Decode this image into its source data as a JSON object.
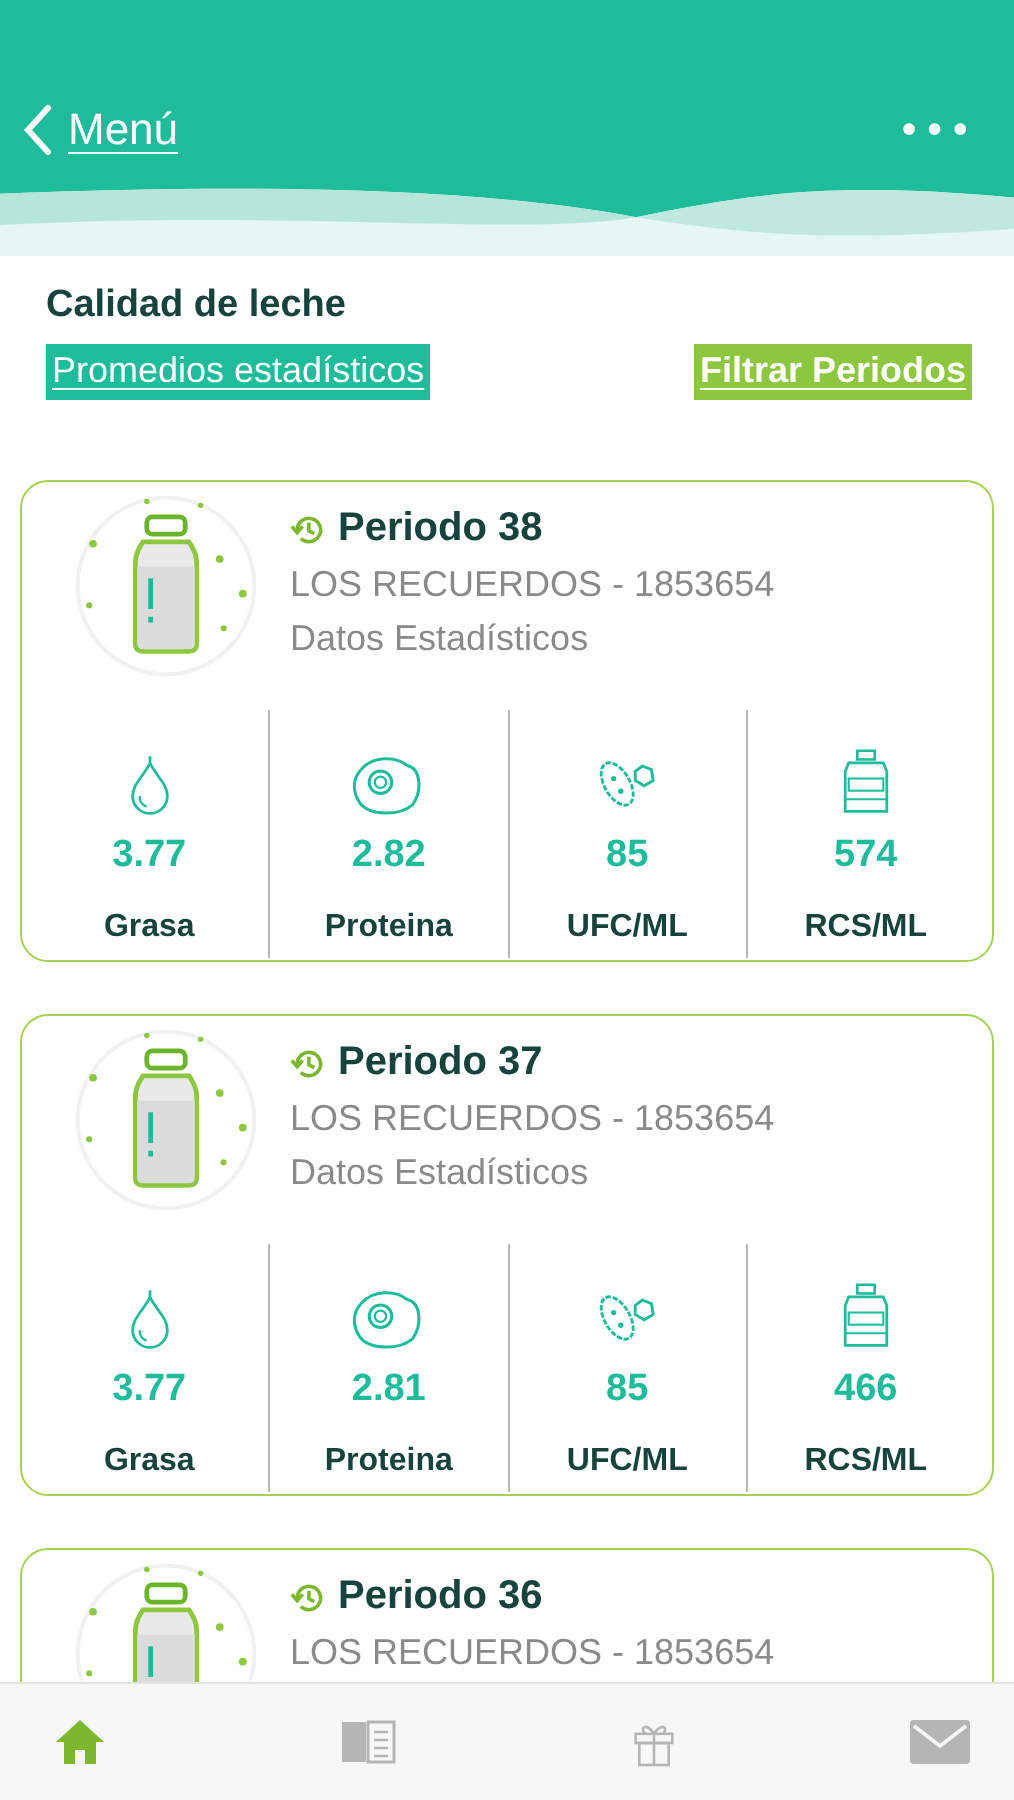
{
  "header": {
    "back_label": "Menú",
    "more": "•••"
  },
  "page_title": "Calidad de leche",
  "actions": [
    {
      "label": "Promedios estadísticos",
      "kind": "primary"
    },
    {
      "label": "Filtrar Periodos",
      "kind": "secondary"
    }
  ],
  "periods": [
    {
      "title": "Periodo 38",
      "farm": "LOS RECUERDOS - 1853654",
      "subtitle": "Datos Estadísticos",
      "metrics": [
        {
          "value": "3.77",
          "label": "Grasa"
        },
        {
          "value": "2.82",
          "label": "Proteina"
        },
        {
          "value": "85",
          "label": "UFC/ML"
        },
        {
          "value": "574",
          "label": "RCS/ML"
        }
      ]
    },
    {
      "title": "Periodo 37",
      "farm": "LOS RECUERDOS - 1853654",
      "subtitle": "Datos Estadísticos",
      "metrics": [
        {
          "value": "3.77",
          "label": "Grasa"
        },
        {
          "value": "2.81",
          "label": "Proteina"
        },
        {
          "value": "85",
          "label": "UFC/ML"
        },
        {
          "value": "466",
          "label": "RCS/ML"
        }
      ]
    },
    {
      "title": "Periodo 36",
      "farm": "LOS RECUERDOS - 1853654"
    }
  ],
  "tab_bar": [
    {
      "kind": "home",
      "selected": true
    },
    {
      "kind": "book",
      "selected": false
    },
    {
      "kind": "gift",
      "selected": false
    },
    {
      "kind": "mail",
      "selected": false
    }
  ]
}
